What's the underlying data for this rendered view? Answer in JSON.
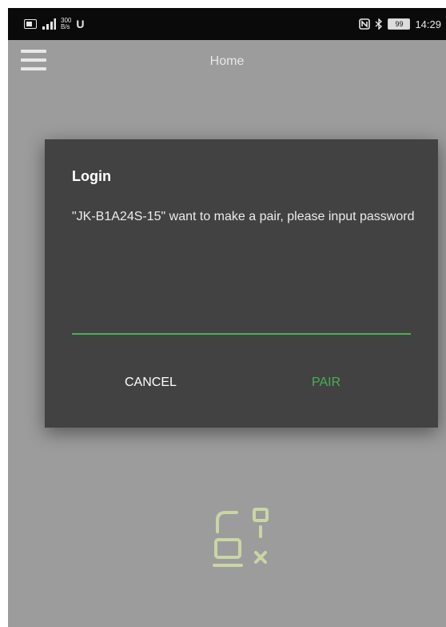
{
  "status_bar": {
    "net_speed_value": "300",
    "net_speed_unit": "B/s",
    "app_badge": "U",
    "battery_level": "99",
    "time": "14:29",
    "icons": [
      "sim-card-icon",
      "signal-icon",
      "nfc-icon",
      "bluetooth-icon",
      "battery-icon"
    ]
  },
  "toolbar": {
    "title": "Home",
    "menu_icon": "hamburger-menu-icon"
  },
  "empty_state": {
    "icon": "devices-disconnected-icon"
  },
  "dialog": {
    "title": "Login",
    "message": "\"JK-B1A24S-15\" want to make a pair, please input password",
    "password_value": "",
    "cancel_label": "CANCEL",
    "pair_label": "PAIR"
  },
  "colors": {
    "accent": "#4caf50",
    "dialog_bg": "#424242",
    "scrim": "#9c9c9c",
    "status_bar": "#0a0a0a"
  }
}
